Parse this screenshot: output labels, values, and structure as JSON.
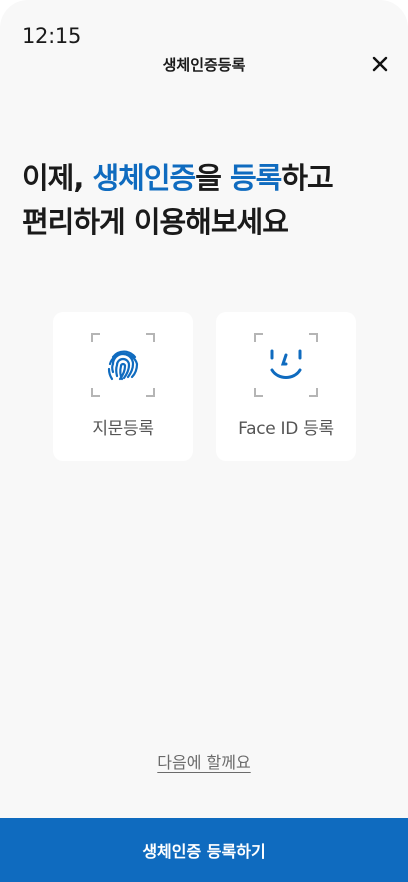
{
  "status_bar": {
    "time": "12:15"
  },
  "header": {
    "title": "생체인증등록",
    "close_icon": "close-icon"
  },
  "headline": {
    "line1_part1": "이제, ",
    "line1_accent1": "생체인증",
    "line1_part2": "을 ",
    "line1_accent2": "등록",
    "line1_part3": "하고",
    "line2": "편리하게 이용해보세요"
  },
  "options": [
    {
      "label": "지문등록",
      "icon": "fingerprint-icon"
    },
    {
      "label": "Face ID 등록",
      "icon": "face-id-icon"
    }
  ],
  "later_link": "다음에 할께요",
  "primary_button": "생체인증 등록하기",
  "colors": {
    "accent": "#0f6bbf",
    "background": "#f8f8f8",
    "card": "#ffffff",
    "corner_marks": "#b5b5b5"
  }
}
